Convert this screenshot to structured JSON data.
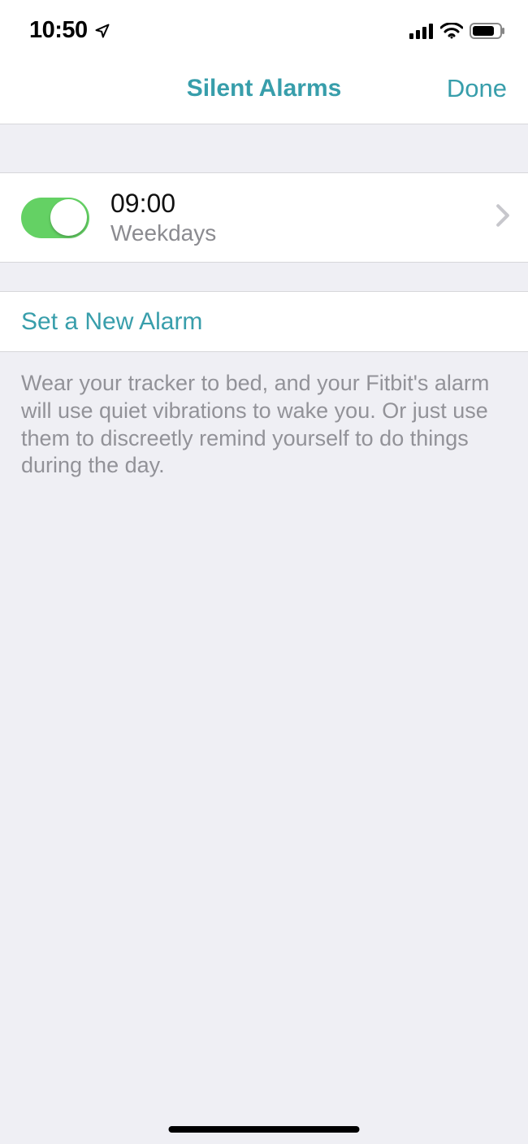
{
  "status_bar": {
    "time": "10:50"
  },
  "header": {
    "title": "Silent Alarms",
    "done_label": "Done"
  },
  "alarms": [
    {
      "time": "09:00",
      "days": "Weekdays",
      "enabled": true
    }
  ],
  "actions": {
    "new_alarm_label": "Set a New Alarm"
  },
  "footer": {
    "description": "Wear your tracker to bed, and your Fitbit's alarm will use quiet vibrations to wake you. Or just use them to discreetly remind yourself to do things during the day."
  },
  "colors": {
    "accent": "#389eab",
    "toggle_on": "#64d164",
    "background": "#efeff4",
    "separator": "#d7d7da",
    "secondary_text": "#929298"
  }
}
